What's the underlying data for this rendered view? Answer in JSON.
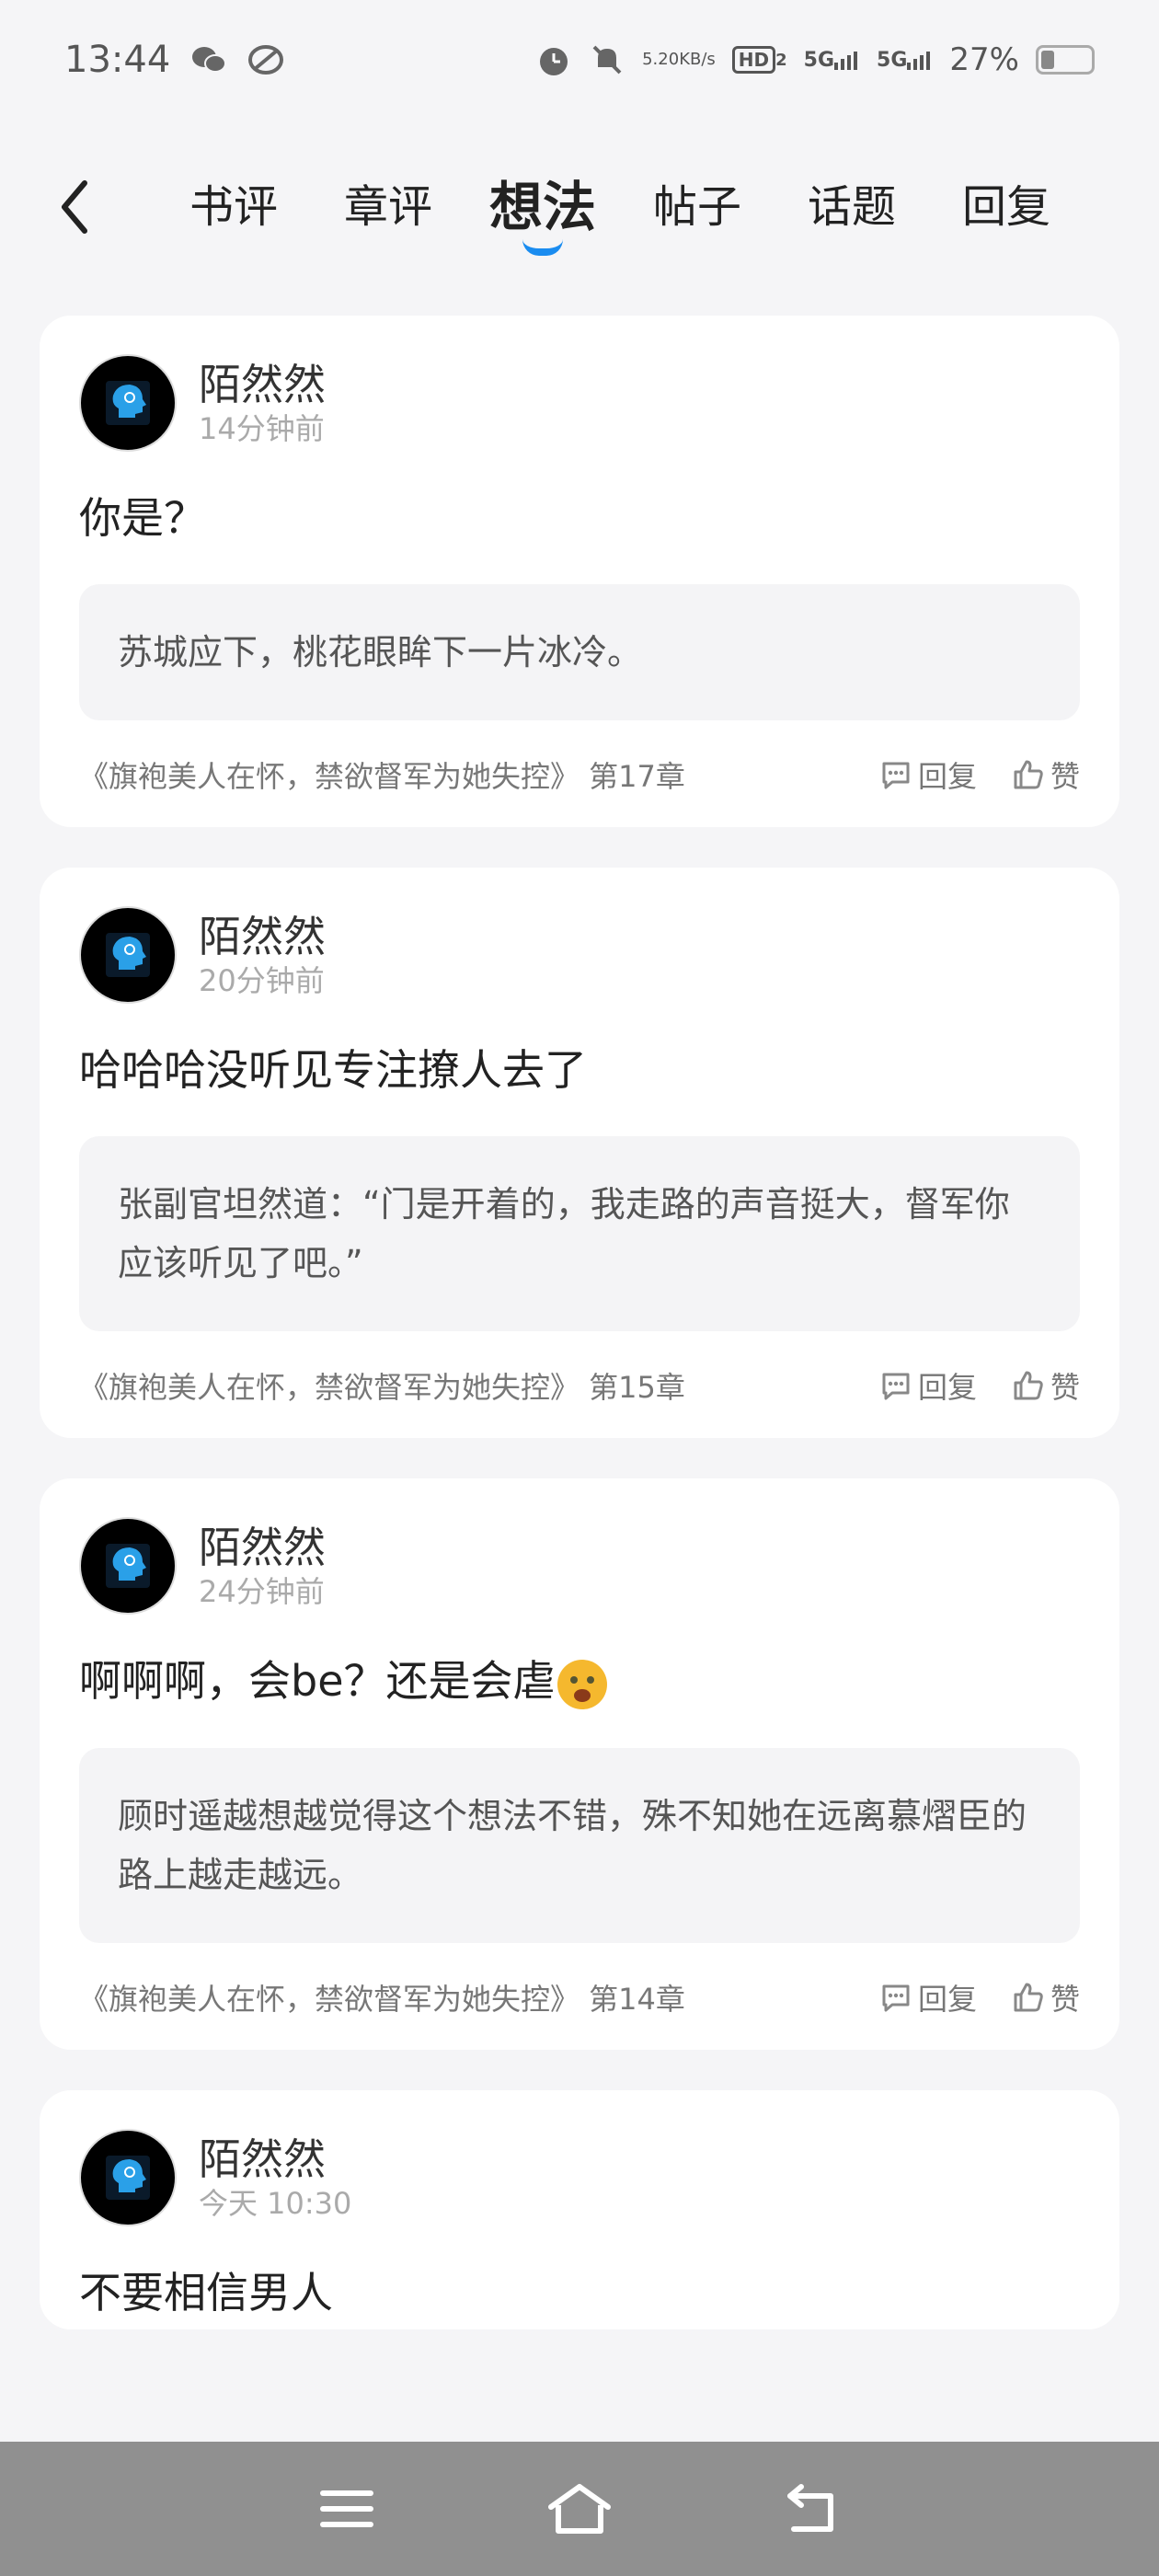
{
  "status_bar": {
    "time": "13:44",
    "net_speed_value": "5.20",
    "net_speed_unit": "KB/s",
    "hd_label": "HD",
    "hd_sub": "2",
    "sig1": "5G",
    "sig2": "5G",
    "battery": "27%"
  },
  "tabs": [
    {
      "label": "书评"
    },
    {
      "label": "章评"
    },
    {
      "label": "想法"
    },
    {
      "label": "帖子"
    },
    {
      "label": "话题"
    },
    {
      "label": "回复"
    }
  ],
  "active_tab": "想法",
  "accent_color": "#1a8cf0",
  "posts": [
    {
      "user": "陌然然",
      "time": "14分钟前",
      "content": "你是？",
      "quote": "苏城应下，桃花眼眸下一片冰冷。",
      "source": "《旗袍美人在怀，禁欲督军为她失控》 第17章",
      "reply_label": "回复",
      "like_label": "赞"
    },
    {
      "user": "陌然然",
      "time": "20分钟前",
      "content": "哈哈哈没听见专注撩人去了",
      "quote": "张副官坦然道：“门是开着的，我走路的声音挺大，督军你应该听见了吧。”",
      "source": "《旗袍美人在怀，禁欲督军为她失控》 第15章",
      "reply_label": "回复",
      "like_label": "赞"
    },
    {
      "user": "陌然然",
      "time": "24分钟前",
      "content": "啊啊啊，会be？还是会虐",
      "quote": "顾时遥越想越觉得这个想法不错，殊不知她在远离慕熠臣的路上越走越远。",
      "source": "《旗袍美人在怀，禁欲督军为她失控》 第14章",
      "reply_label": "回复",
      "like_label": "赞"
    },
    {
      "user": "陌然然",
      "time": "今天 10:30",
      "content": "不要相信男人"
    }
  ]
}
